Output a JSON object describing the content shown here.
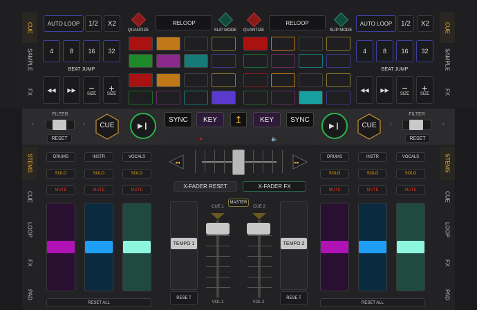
{
  "top": {
    "autoloop": "AUTO LOOP",
    "half": "1/2",
    "x2": "X2",
    "beatjump_label": "BEAT JUMP",
    "beats": [
      "4",
      "8",
      "16",
      "32"
    ],
    "size_label": "SIZE",
    "quantize": "QUANTIZE",
    "reloop": "RELOOP",
    "slip_mode": "SLIP MODE"
  },
  "side_tabs_top": [
    "CUE",
    "SAMPLE",
    "FX"
  ],
  "side_tabs_bottom": [
    "STEMS",
    "CUE",
    "LOOP",
    "FX",
    "PAD"
  ],
  "controls": {
    "filter": "FILTER",
    "reset": "RESET",
    "cue": "CUE",
    "sync": "SYNC",
    "key": "KEY"
  },
  "stems": {
    "drums": "DRUMS",
    "instr": "INSTR",
    "vocals": "VOCALS",
    "solo": "SOLO",
    "mute": "MUTE",
    "reset_all": "RESET ALL"
  },
  "mixer": {
    "xfader_reset": "X-FADER RESET",
    "xfader_fx": "X-FADER FX",
    "master": "MASTER",
    "cue1": "CUE 1",
    "cue2": "CUE 2",
    "tempo1": "TEMPO 1",
    "tempo2": "TEMPO 2",
    "reset": "RESE T",
    "vol1": "VOL 1",
    "vol2": "VOL 2"
  },
  "colors": {
    "accent": "#f0b030",
    "play_green": "#2bb54a",
    "stem_drums": "#b012b6",
    "stem_instr": "#1e9ff5",
    "stem_vocals": "#8ef5de",
    "key_purple": "#3a1a4a"
  }
}
